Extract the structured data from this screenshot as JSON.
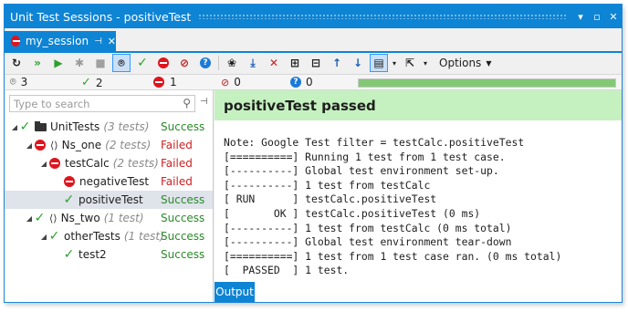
{
  "window": {
    "title": "Unit Test Sessions - positiveTest",
    "controls": {
      "dropdown": "▾",
      "restore": "▫",
      "close": "✕"
    }
  },
  "tab": {
    "label": "my_session",
    "pin": "⊣",
    "close": "✕"
  },
  "toolbar": {
    "options_label": "Options",
    "icons": [
      "refresh-icon",
      "run-all-icon",
      "run-icon",
      "debug-icon",
      "stop-icon",
      "track-running-icon",
      "show-passed-icon",
      "show-failed-icon",
      "show-ignored-icon",
      "show-unknown-icon",
      "cover-icon",
      "import-icon",
      "remove-icon",
      "expand-all-icon",
      "collapse-all-icon",
      "previous-icon",
      "next-icon",
      "group-by-icon",
      "export-icon"
    ]
  },
  "summary": {
    "total": "3",
    "passed": "2",
    "failed": "1",
    "ignored": "0",
    "unknown": "0",
    "progress_fraction": 1.0
  },
  "search": {
    "placeholder": "Type to search"
  },
  "tree": [
    {
      "level": 0,
      "name": "UnitTests",
      "count": "(3 tests)",
      "status": "Success",
      "result": "pass",
      "kind": "project",
      "expanded": true
    },
    {
      "level": 1,
      "name": "Ns_one",
      "count": "(2 tests)",
      "status": "Failed",
      "result": "fail",
      "kind": "namespace",
      "expanded": true
    },
    {
      "level": 2,
      "name": "testCalc",
      "count": "(2 tests)",
      "status": "Failed",
      "result": "fail",
      "kind": "class",
      "expanded": true
    },
    {
      "level": 3,
      "name": "negativeTest",
      "count": "",
      "status": "Failed",
      "result": "fail",
      "kind": "test"
    },
    {
      "level": 3,
      "name": "positiveTest",
      "count": "",
      "status": "Success",
      "result": "pass",
      "kind": "test",
      "selected": true
    },
    {
      "level": 1,
      "name": "Ns_two",
      "count": "(1 test)",
      "status": "Success",
      "result": "pass",
      "kind": "namespace",
      "expanded": true
    },
    {
      "level": 2,
      "name": "otherTests",
      "count": "(1 test)",
      "status": "Success",
      "result": "pass",
      "kind": "class",
      "expanded": true
    },
    {
      "level": 3,
      "name": "test2",
      "count": "",
      "status": "Success",
      "result": "pass",
      "kind": "test"
    }
  ],
  "detail": {
    "header": "positiveTest passed",
    "output": [
      "Note: Google Test filter = testCalc.positiveTest",
      "[==========] Running 1 test from 1 test case.",
      "[----------] Global test environment set-up.",
      "[----------] 1 test from testCalc",
      "[ RUN      ] testCalc.positiveTest",
      "[       OK ] testCalc.positiveTest (0 ms)",
      "[----------] 1 test from testCalc (0 ms total)",
      "[----------] Global test environment tear-down",
      "[==========] 1 test from 1 test case ran. (0 ms total)",
      "[  PASSED  ] 1 test."
    ]
  },
  "bottom_tab": {
    "label": "Output"
  },
  "colors": {
    "accent": "#0e84d4",
    "pass": "#2ea02e",
    "fail": "#e0141d",
    "passed_header": "#c5f1c0",
    "progress": "#83c875"
  }
}
